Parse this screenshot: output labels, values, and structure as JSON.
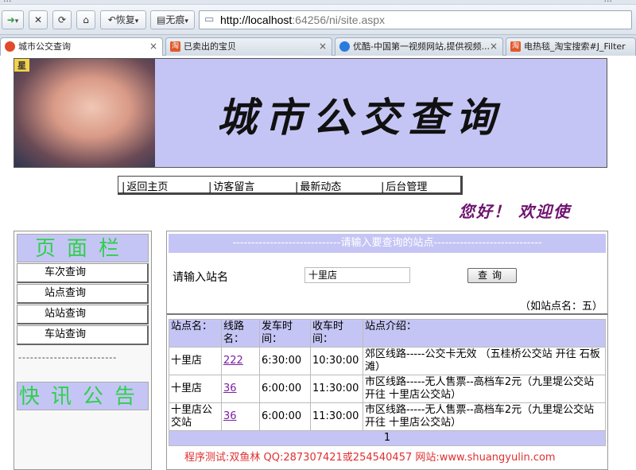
{
  "browser": {
    "titlebar_left": "...",
    "titlebar_right": "...",
    "back_label": "➜",
    "back_menu": "▾",
    "stop_label": "✕",
    "refresh_label": "⟳",
    "home_label": "⌂",
    "restore_label": "恢复",
    "noads_label": "无痕",
    "url_host": "http://localhost",
    "url_rest": ":64256/ni/site.aspx",
    "tabs": [
      {
        "label": "城市公交查询",
        "active": true
      },
      {
        "label": "已卖出的宝贝",
        "active": false
      },
      {
        "label": "优酷-中国第一视频网站,提供视频...",
        "active": false
      },
      {
        "label": "电热毯_淘宝搜索#J_Filter",
        "active": false
      }
    ],
    "tab_close": "×",
    "tab_fav": "淘"
  },
  "banner": {
    "photo_tag": "星",
    "title": "城市公交查询"
  },
  "nav": {
    "items": [
      "返回主页",
      "访客留言",
      "最新动态",
      "后台管理"
    ]
  },
  "welcome": "您好！ 欢迎使",
  "sidebar": {
    "menu_title": "页面栏",
    "items": [
      "车次查询",
      "站点查询",
      "站站查询",
      "车站查询"
    ],
    "dashes": "-------------------------",
    "notice_title": "快讯公告"
  },
  "query": {
    "header": "-----------------------------请输入要查询的站点-----------------------------",
    "label": "请输入站名",
    "input_value": "十里店",
    "button": "查询",
    "hint": "（如站点名：五）"
  },
  "results": {
    "headers": [
      "站点名：",
      "线路名：",
      "发车时间：",
      "收车时间：",
      "站点介绍："
    ],
    "rows": [
      {
        "station": "十里店",
        "line": "222",
        "start": "6:30:00",
        "end": "10:30:00",
        "intro": "郊区线路-----公交卡无效 （五桂桥公交站 开往 石板滩）"
      },
      {
        "station": "十里店",
        "line": "36",
        "start": "6:00:00",
        "end": "11:30:00",
        "intro": "市区线路-----无人售票--高档车2元（九里堤公交站 开往 十里店公交站）"
      },
      {
        "station": "十里店公交站",
        "line": "36",
        "start": "6:00:00",
        "end": "11:30:00",
        "intro": "市区线路-----无人售票--高档车2元（九里堤公交站 开往 十里店公交站）"
      }
    ],
    "page": "1"
  },
  "footer": "程序测试:双鱼林 QQ:287307421或254540457 网站:www.shuangyulin.com"
}
